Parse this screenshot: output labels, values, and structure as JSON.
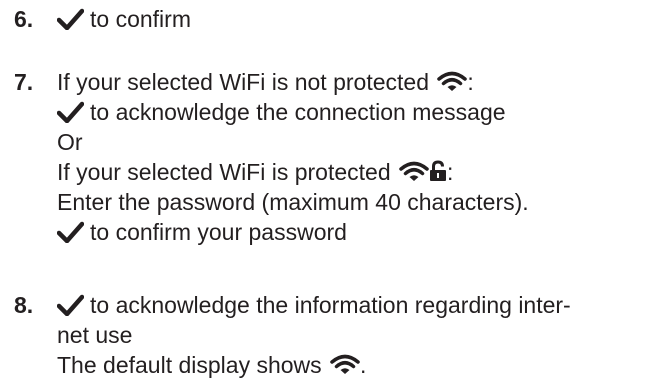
{
  "steps": [
    {
      "number": "6.",
      "lines": [
        {
          "text": "to confirm"
        }
      ]
    },
    {
      "number": "7.",
      "lines": [
        {
          "text_before": "If your selected WiFi is not protected",
          "text_after": ":"
        },
        {
          "text": "to acknowledge the connection message"
        },
        {
          "text": "Or"
        },
        {
          "text_before": "If your selected WiFi is protected",
          "text_after": ":"
        },
        {
          "text": "Enter the password (maximum 40 characters)."
        },
        {
          "text": "to confirm your password"
        }
      ]
    },
    {
      "number": "8.",
      "lines": [
        {
          "text": "to acknowledge the information regarding inter-"
        },
        {
          "text": "net use"
        },
        {
          "text_before": "The default display shows",
          "text_after": "."
        }
      ]
    }
  ],
  "icons": {
    "check": "check-icon",
    "wifi": "wifi-icon",
    "lock": "lock-icon"
  },
  "colors": {
    "text": "#231f20"
  }
}
